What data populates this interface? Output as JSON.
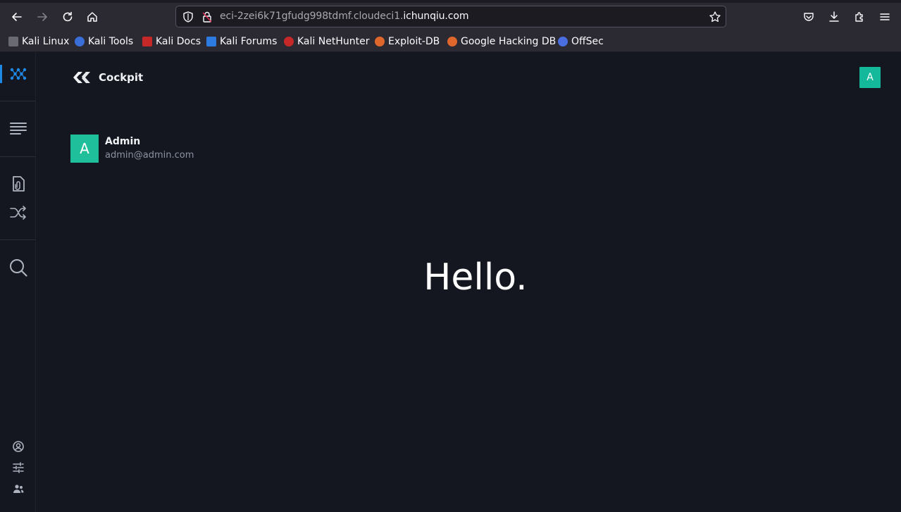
{
  "browser": {
    "url_prefix": "eci-2zei6k71gfudg998tdmf.cloudeci1.",
    "url_domain": "ichunqiu.com",
    "bookmarks": [
      {
        "label": "Kali Linux",
        "color": "#d0d0d0"
      },
      {
        "label": "Kali Tools",
        "color": "#3b6fd8"
      },
      {
        "label": "Kali Docs",
        "color": "#c62828"
      },
      {
        "label": "Kali Forums",
        "color": "#2d7be0"
      },
      {
        "label": "Kali NetHunter",
        "color": "#c62828"
      },
      {
        "label": "Exploit-DB",
        "color": "#e0672c"
      },
      {
        "label": "Google Hacking DB",
        "color": "#e0672c"
      },
      {
        "label": "OffSec",
        "color": "#4a6ee0"
      }
    ]
  },
  "app": {
    "brand": "Cockpit",
    "top_avatar_letter": "A",
    "user": {
      "avatar_letter": "A",
      "name": "Admin",
      "email": "admin@admin.com"
    },
    "greeting": "Hello."
  },
  "colors": {
    "accent": "#1e88e5",
    "avatar": "#1fbf9c",
    "background": "#141720"
  }
}
